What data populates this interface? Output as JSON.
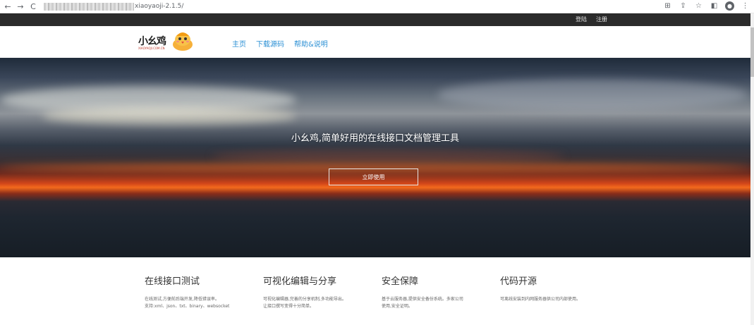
{
  "browser": {
    "url_visible": "xiaoyaoji-2.1.5/"
  },
  "topbar": {
    "login": "登陆",
    "register": "注册"
  },
  "header": {
    "logo_text": "小幺鸡",
    "logo_sub": "XIAOYAOJI.COM.CN",
    "nav": [
      "主页",
      "下载源码",
      "帮助&说明"
    ]
  },
  "hero": {
    "title": "小幺鸡,简单好用的在线接口文档管理工具",
    "button": "立即使用"
  },
  "features": [
    {
      "title": "在线接口测试",
      "desc": [
        "在线测试,方便前后端开发,降低错误率。",
        "支持:xml、json、txt、binary、websocket"
      ]
    },
    {
      "title": "可视化编辑与分享",
      "desc": [
        "可视化编辑器,完善的分享机制,多功能导出。",
        "让接口撰写变得十分简单。"
      ]
    },
    {
      "title": "安全保障",
      "desc": [
        "基于云服务器,提供安全备份系统。多家公司",
        "使用,安全证明。"
      ]
    },
    {
      "title": "代码开源",
      "desc": [
        "可离线安装到内网服务器供公司内部使用。"
      ]
    }
  ],
  "colors": {
    "nav_link": "#2a8fd4",
    "topbar_bg": "#2b2b2b"
  }
}
